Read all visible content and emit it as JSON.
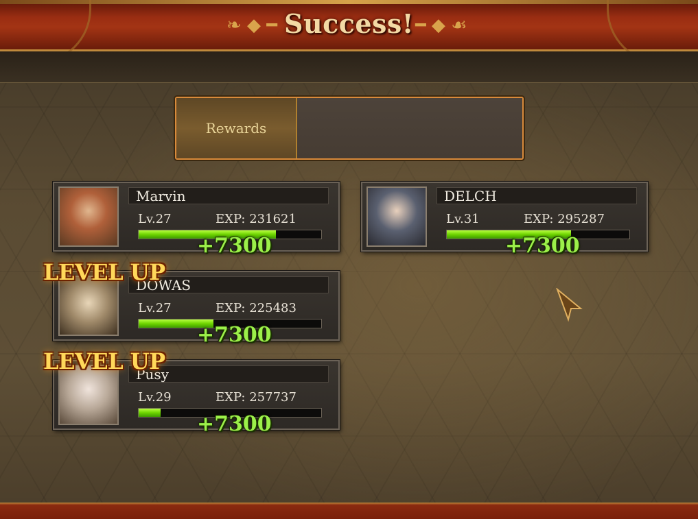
{
  "title": "Success!",
  "rewards": {
    "label": "Rewards"
  },
  "characters": [
    {
      "name": "Marvin",
      "level": "Lv.27",
      "exp": "EXP: 231621",
      "exp_fill": 0.75,
      "gain": "+7300",
      "level_up": ""
    },
    {
      "name": "DELCH",
      "level": "Lv.31",
      "exp": "EXP: 295287",
      "exp_fill": 0.68,
      "gain": "+7300",
      "level_up": ""
    },
    {
      "name": "DOWAS",
      "level": "Lv.27",
      "exp": "EXP: 225483",
      "exp_fill": 0.41,
      "gain": "+7300",
      "level_up": "LEVEL UP"
    },
    {
      "name": "Pusy",
      "level": "Lv.29",
      "exp": "EXP: 257737",
      "exp_fill": 0.12,
      "gain": "+7300",
      "level_up": "LEVEL UP"
    }
  ],
  "colors": {
    "accent": "#d98a3a",
    "exp_bar": "#6ed400",
    "gain_text": "#9cf04a",
    "level_up": "#ffd85a"
  }
}
